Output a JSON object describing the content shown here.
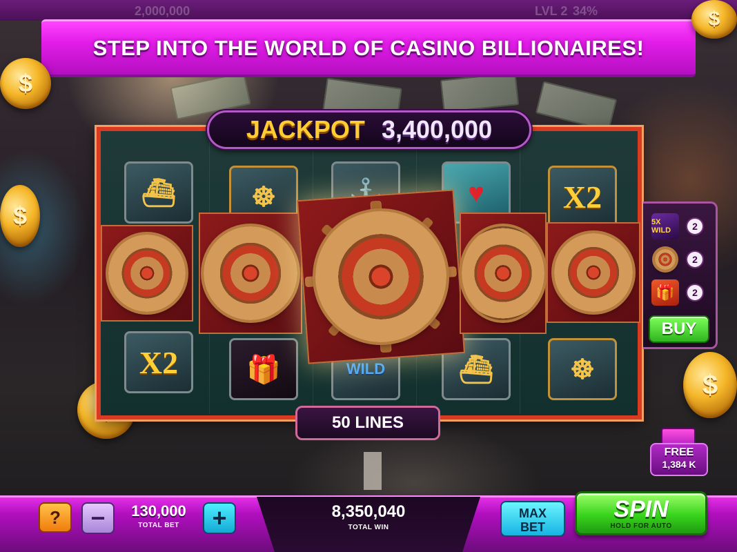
{
  "top_bar": {
    "balance": "2,000,000",
    "level": "LVL 2",
    "progress": "34%"
  },
  "banner": {
    "text": "STEP INTO THE WORLD OF CASINO BILLIONAIRES!"
  },
  "jackpot": {
    "label": "JACKPOT",
    "value": "3,400,000"
  },
  "reels": {
    "top_row": [
      "yacht",
      "ship-wheel",
      "anchor",
      "heart-wild",
      "X2"
    ],
    "bottom_row": [
      "X2",
      "gift-box",
      "WILD",
      "yacht",
      "ship-wheel"
    ],
    "wild_text": "WILD",
    "x2_text": "X2"
  },
  "lines": {
    "label": "50 LINES"
  },
  "side_panel": {
    "items": [
      {
        "icon": "wild-5x-icon",
        "icon_text": "5X WILD",
        "count": "2"
      },
      {
        "icon": "ship-wheel-icon",
        "count": "2"
      },
      {
        "icon": "gift-icon",
        "count": "2"
      }
    ],
    "buy_label": "BUY"
  },
  "free_bonus": {
    "label": "FREE",
    "amount": "1,384 K"
  },
  "bottom": {
    "help_label": "?",
    "minus_label": "−",
    "plus_label": "+",
    "total_bet_value": "130,000",
    "total_bet_label": "TOTAL BET",
    "total_win_value": "8,350,040",
    "total_win_label": "TOTAL WIN",
    "max_bet_label_1": "MAX",
    "max_bet_label_2": "BET",
    "spin_label": "SPIN",
    "spin_sub": "HOLD FOR AUTO"
  },
  "colors": {
    "banner": "#e21ce8",
    "jackpot_gold": "#ffcc33",
    "spin_green": "#38d41c",
    "frame_red": "#d83a22"
  }
}
